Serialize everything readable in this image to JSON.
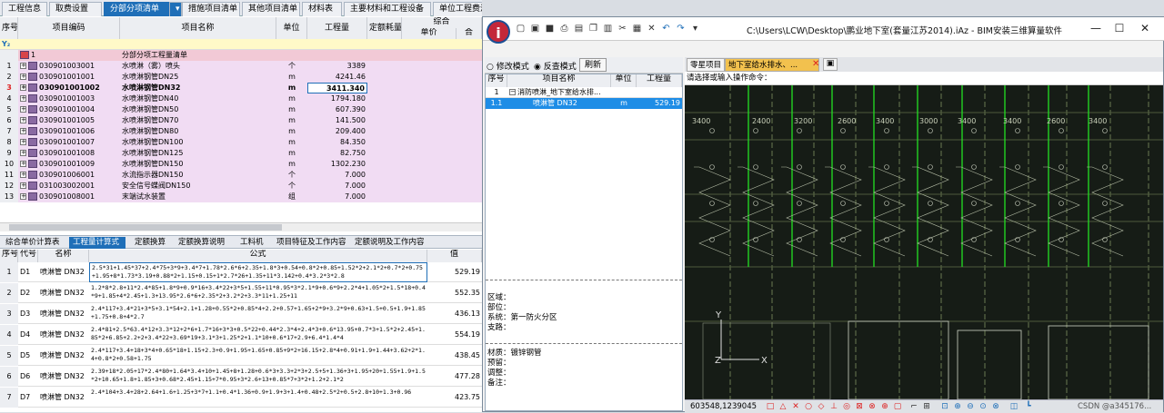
{
  "top_tabs": [
    "工程信息",
    "取费设置",
    "分部分项清单",
    "措施项目清单",
    "其他项目清单",
    "材料表",
    "主要材料和工程设备",
    "单位工程费汇总表"
  ],
  "top_tabs_active": 2,
  "grid": {
    "headers": {
      "seq": "序号",
      "code": "项目编码",
      "name": "项目名称",
      "unit": "单位",
      "qty": "工程量",
      "norm": "定额耗量",
      "composite": "综合",
      "unit_price": "单价",
      "extra": "合"
    },
    "filter_symbol": "Y₂",
    "rows": [
      {
        "seq": "",
        "code": "1",
        "name": "分部分项工程量清单",
        "unit": "",
        "qty": "",
        "style": "pink"
      },
      {
        "seq": "1",
        "code": "030901003001",
        "name": "水喷淋（雾）喷头",
        "unit": "个",
        "qty": "3389",
        "style": "lilac"
      },
      {
        "seq": "2",
        "code": "030901001001",
        "name": "水喷淋钢管DN25",
        "unit": "m",
        "qty": "4241.46",
        "style": "lilac"
      },
      {
        "seq": "3",
        "code": "030901001002",
        "name": "水喷淋钢管DN32",
        "unit": "m",
        "qty": "3411.340",
        "style": "selected"
      },
      {
        "seq": "4",
        "code": "030901001003",
        "name": "水喷淋钢管DN40",
        "unit": "m",
        "qty": "1794.180",
        "style": "lilac"
      },
      {
        "seq": "5",
        "code": "030901001004",
        "name": "水喷淋钢管DN50",
        "unit": "m",
        "qty": "607.390",
        "style": "lilac"
      },
      {
        "seq": "6",
        "code": "030901001005",
        "name": "水喷淋钢管DN70",
        "unit": "m",
        "qty": "141.500",
        "style": "lilac"
      },
      {
        "seq": "7",
        "code": "030901001006",
        "name": "水喷淋钢管DN80",
        "unit": "m",
        "qty": "209.400",
        "style": "lilac"
      },
      {
        "seq": "8",
        "code": "030901001007",
        "name": "水喷淋钢管DN100",
        "unit": "m",
        "qty": "84.350",
        "style": "lilac"
      },
      {
        "seq": "9",
        "code": "030901001008",
        "name": "水喷淋钢管DN125",
        "unit": "m",
        "qty": "82.750",
        "style": "lilac"
      },
      {
        "seq": "10",
        "code": "030901001009",
        "name": "水喷淋钢管DN150",
        "unit": "m",
        "qty": "1302.230",
        "style": "lilac"
      },
      {
        "seq": "11",
        "code": "030901006001",
        "name": "水流指示器DN150",
        "unit": "个",
        "qty": "7.000",
        "style": "lilac"
      },
      {
        "seq": "12",
        "code": "031003002001",
        "name": "安全信号蝶阀DN150",
        "unit": "个",
        "qty": "7.000",
        "style": "lilac"
      },
      {
        "seq": "13",
        "code": "030901008001",
        "name": "末端试水装置",
        "unit": "组",
        "qty": "7.000",
        "style": "lilac"
      }
    ]
  },
  "bottom_tabs": [
    "综合单价计算表",
    "工程量计算式",
    "定额换算",
    "定额换算说明",
    "工料机",
    "项目特征及工作内容",
    "定额说明及工作内容"
  ],
  "bottom_tabs_active": 1,
  "bottom_grid": {
    "headers": {
      "seq": "序号",
      "code": "代号",
      "name": "名称",
      "formula": "公式",
      "value": "值"
    },
    "rows": [
      {
        "seq": "1",
        "code": "D1",
        "name": "喷淋管 DN32",
        "formula": "2.5*31+1.45*37+2.4*75+3*9+3.4*7+1.78*2.6*6+2.35+1.8*3+0.54+0.8*2+0.85+1.52*2+2.1*2+0.7*2+0.75+1.95+8*1.73*3.19+0.88*2+1.15+0.15+1*2.7*26+1.35+11*3.142+0.4*3.2*3*2.8",
        "value": "529.19"
      },
      {
        "seq": "2",
        "code": "D2",
        "name": "喷淋管 DN32",
        "formula": "1.2*8*2.8+11*2.4*85+1.8*9+0.9*16+3.4*22+3*5+1.55+11*0.95*3*2.1*9+0.6*9+2.2*4+1.05*2+1.5*18+0.4*9+1.85+4*2.45+1.3+13.95*2.6*6+2.35*2+3.2*2+3.3*11+1.25+11",
        "value": "552.35"
      },
      {
        "seq": "3",
        "code": "D3",
        "name": "喷淋管 DN32",
        "formula": "2.4*117+3.4*21+3*5+3.1*54+2.1+1.28+0.55*2+0.85*4+2.2+0.57+1.65+2*9+3.2*9+0.63+1.5+0.5+1.9+1.85+1.75+0.8+4*2.7",
        "value": "436.13"
      },
      {
        "seq": "4",
        "code": "D4",
        "name": "喷淋管 DN32",
        "formula": "2.4*81+2.5*63.4*12+3.3*12+2*6+1.7*16+3*3+0.5*22+0.44*2.3*4+2.4*3+0.6*13.95+0.7*3+1.5*2+2.45+1.85*2+6.85+2.2+2+3.4*22+3.69*19+3.1*3+1.25*2+1.1*10+0.6*17+2.9+6.4*1.4*4",
        "value": "554.19"
      },
      {
        "seq": "5",
        "code": "D5",
        "name": "喷淋管 DN32",
        "formula": "2.4*117+3.4+18+3*4+0.65*18+1.15+2.3+0.9+1.95+1.65+0.85+9*2+16.15+2.8*4+0.91+1.9+1.44+3.62+2*1.4+0.8*2+0.58+1.75",
        "value": "438.45"
      },
      {
        "seq": "6",
        "code": "D6",
        "name": "喷淋管 DN32",
        "formula": "2.39+18*2.05+17*2.4*80+1.64*3.4+10+1.45+8+1.28+0.6*3+3.3+2*3+2.5+5+1.36+3+1.95+20+1.55+1.9+1.5*2+10.65+1.8+1.85+3+0.68*2.45+1.15+7*0.95+3*2.6+13+0.85*7+3*2+1.2+2.1*2",
        "value": "477.28"
      },
      {
        "seq": "7",
        "code": "D7",
        "name": "喷淋管 DN32",
        "formula": "2.4*104+3.4+28+2.64+1.6+1.25+3*7+1.1+0.4*1.36+0.9+1.9+3+1.4+0.48+2.5*2+0.5+2.8+10+1.3+0.96",
        "value": "423.75"
      }
    ]
  },
  "app": {
    "title": "C:\\Users\\LCW\\Desktop\\鹏业地下室(套量江苏2014).iAz - BIM安装三维算量软件",
    "logo": "i",
    "mode_options": [
      "修改模式",
      "反查模式"
    ],
    "mode_selected": 1,
    "refresh_label": "刷新",
    "left_table_headers": {
      "seq": "序号",
      "name": "项目名称",
      "unit": "单位",
      "qty": "工程量"
    },
    "left_rows": [
      {
        "seq": "1",
        "name": "消防喷淋_地下室给水排...",
        "unit": "",
        "qty": ""
      },
      {
        "seq": "1.1",
        "name": "喷淋管 DN32",
        "unit": "m",
        "qty": "529.19"
      }
    ],
    "info": {
      "region": "区域：",
      "part": "部位：",
      "system": "系统：第一防火分区",
      "support": "支路：",
      "material": "材质：镀锌钢管",
      "reserve": "预留：",
      "adjust": "调整：",
      "note": "备注："
    },
    "cad_tabs": [
      "零星项目",
      "地下室给水排水、..."
    ],
    "command_prompt": "请选择或输入操作命令：",
    "coords": "603548,1239045",
    "watermark": "CSDN @a345176..."
  },
  "colors": {
    "accent": "#1f6fb8",
    "lilac": "#f1dcf3",
    "pink": "#f2c9d6",
    "cad_bg": "#161c16",
    "pipe_green": "#22e022"
  }
}
